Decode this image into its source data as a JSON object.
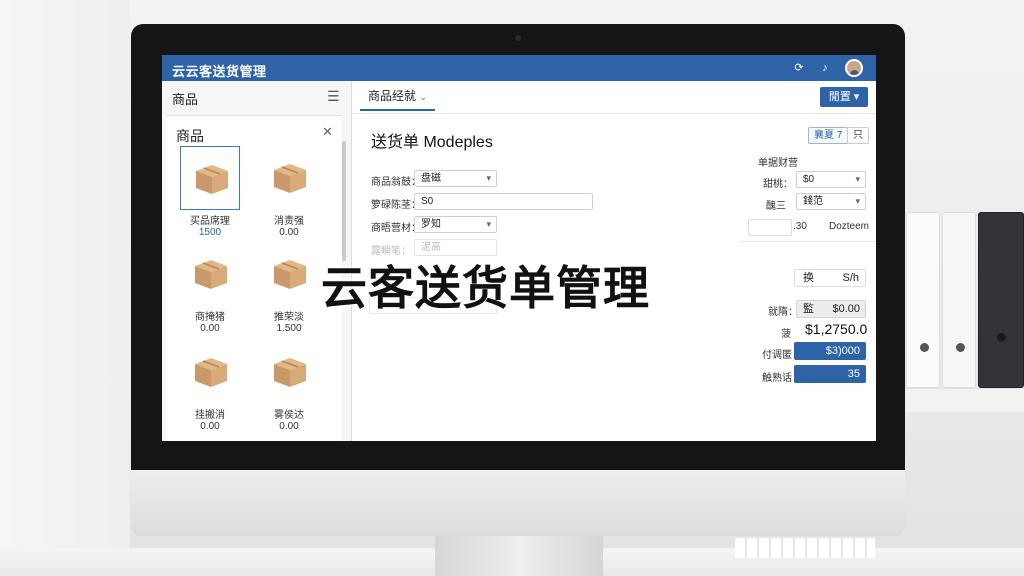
{
  "window": {
    "title": "云云客送货管理"
  },
  "header": {
    "icons": [
      "refresh-icon",
      "bell-icon"
    ]
  },
  "sidebar": {
    "title": "商品",
    "panel_title": "商品",
    "products": [
      {
        "name": "买品席理",
        "price": "1500"
      },
      {
        "name": "消责强",
        "price": "0.00"
      },
      {
        "name": "商掩猪",
        "price": "0.00"
      },
      {
        "name": "推荣淡",
        "price": "1.500"
      },
      {
        "name": "挂搬消",
        "price": "0.00"
      },
      {
        "name": "雾侯达",
        "price": "0.00"
      }
    ]
  },
  "main": {
    "tab_label": "商品经就",
    "top_button": "閒置",
    "form_title": "送货单 Modeples",
    "save_button": "襄夏 7",
    "print_button": "只",
    "fields": [
      {
        "label": "商品翁鼓：",
        "value": "盘磁"
      },
      {
        "label": "箩碌陈茎：",
        "value": "S0"
      },
      {
        "label": "商晤营材：",
        "value": "罗知"
      },
      {
        "label": "露瞬笔：",
        "value": "泥高"
      }
    ]
  },
  "right_panel": {
    "header": "单据财营",
    "rows": [
      {
        "label": "甜桃：",
        "value": "$0"
      },
      {
        "label": "醜三",
        "value": "錢范"
      }
    ],
    "qty": ".30",
    "unit": "Dozteem",
    "sum_label": "换",
    "sum_value": "S/h",
    "subtotal_label": "就隋：",
    "subtotal_prefix": "監",
    "subtotal_value": "$0.00",
    "total_prefix": "菠",
    "total_value": "$1,2750.0",
    "paid_label": "付调匿：",
    "paid_value": "$3)000",
    "count_label": "触熟话：",
    "count_value": "35"
  },
  "overlay": {
    "headline": "云客送货单管理"
  }
}
